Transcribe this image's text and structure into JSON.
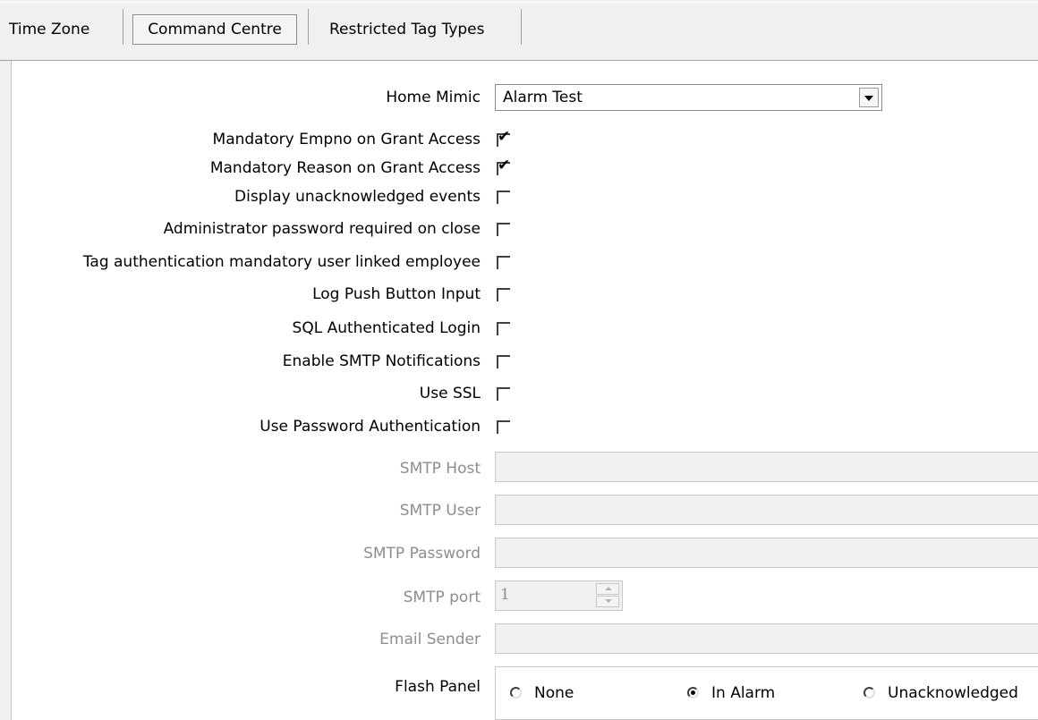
{
  "tabs": [
    {
      "label": "Time Zone",
      "active": false
    },
    {
      "label": "Command Centre",
      "active": true
    },
    {
      "label": "Restricted Tag Types",
      "active": false
    }
  ],
  "home_mimic": {
    "label": "Home Mimic",
    "value": "Alarm Test"
  },
  "options": [
    {
      "label": "Mandatory Empno on Grant Access",
      "checked": true
    },
    {
      "label": "Mandatory Reason on Grant Access",
      "checked": true
    },
    {
      "label": "Display unacknowledged events",
      "checked": false
    },
    {
      "label": "Administrator password required on close",
      "checked": false
    },
    {
      "label": "Tag authentication mandatory user linked employee",
      "checked": false
    },
    {
      "label": "Log Push Button Input",
      "checked": false
    },
    {
      "label": "SQL Authenticated Login",
      "checked": false
    },
    {
      "label": "Enable SMTP Notifications",
      "checked": false
    },
    {
      "label": "Use SSL",
      "checked": false
    },
    {
      "label": "Use Password Authentication",
      "checked": false
    }
  ],
  "smtp": {
    "host_label": "SMTP Host",
    "host_value": "",
    "user_label": "SMTP User",
    "user_value": "",
    "password_label": "SMTP Password",
    "password_value": "",
    "port_label": "SMTP port",
    "port_value": "1",
    "sender_label": "Email Sender",
    "sender_value": ""
  },
  "flash_panel": {
    "label": "Flash Panel",
    "options": [
      {
        "label": "None",
        "selected": false
      },
      {
        "label": "In Alarm",
        "selected": true
      },
      {
        "label": "Unacknowledged",
        "selected": false
      }
    ]
  }
}
